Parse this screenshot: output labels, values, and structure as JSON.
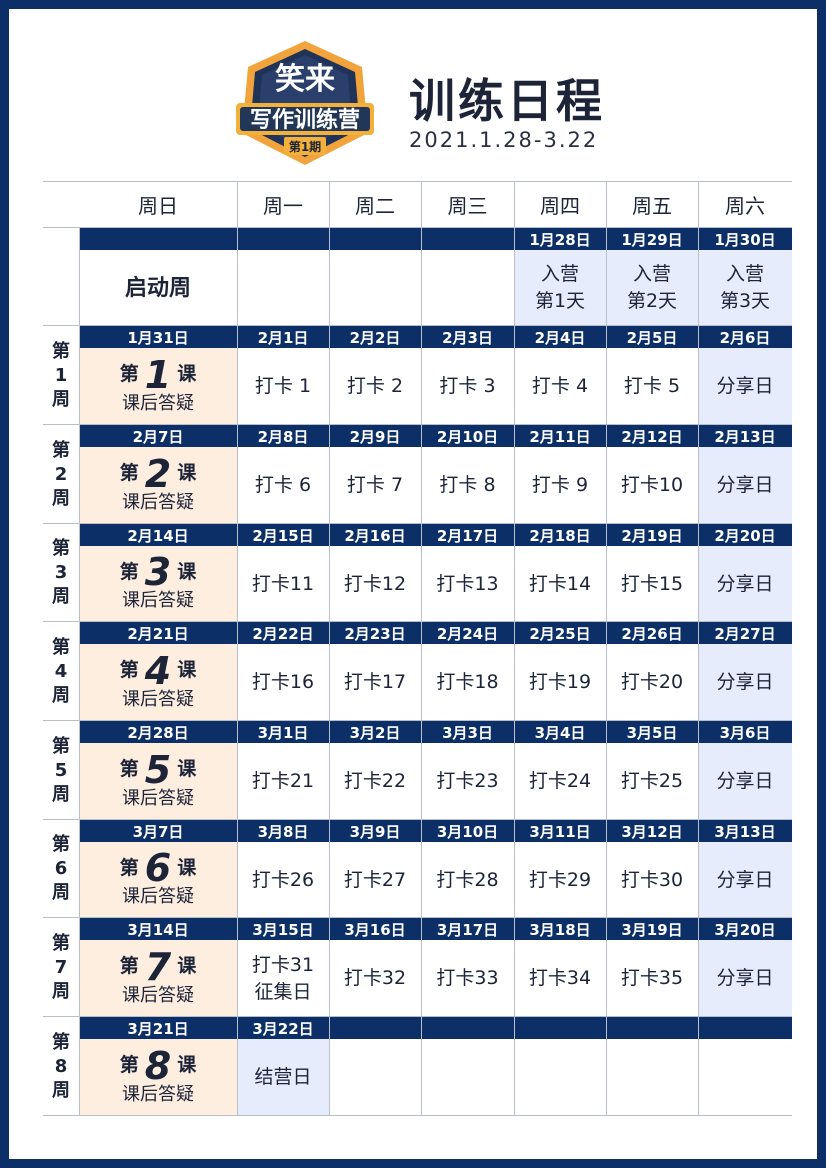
{
  "header": {
    "logo_text_top": "笑来",
    "logo_text_main": "写作训练营",
    "logo_badge": "第1期",
    "title": "训练日程",
    "subtitle": "2021.1.28-3.22"
  },
  "colors": {
    "navy": "#0b2f66",
    "peach": "#fdeee0",
    "light_blue": "#e6ecfb"
  },
  "days": [
    "周日",
    "周一",
    "周二",
    "周三",
    "周四",
    "周五",
    "周六"
  ],
  "launch_week": {
    "label": "启动周",
    "dates": [
      "",
      "",
      "",
      "",
      "1月28日",
      "1月29日",
      "1月30日"
    ],
    "cells": [
      {
        "text": ""
      },
      {
        "text": ""
      },
      {
        "text": ""
      },
      {
        "text": "入营\n第1天",
        "style": "blue"
      },
      {
        "text": "入营\n第2天",
        "style": "blue"
      },
      {
        "text": "入营\n第3天",
        "style": "blue"
      }
    ]
  },
  "weeks": [
    {
      "label": [
        "第",
        "1",
        "周"
      ],
      "lesson": {
        "prefix": "第",
        "num": "1",
        "suffix": "课",
        "sub": "课后答疑"
      },
      "dates": [
        "1月31日",
        "2月1日",
        "2月2日",
        "2月3日",
        "2月4日",
        "2月5日",
        "2月6日"
      ],
      "cells": [
        {
          "text": "打卡 1"
        },
        {
          "text": "打卡 2"
        },
        {
          "text": "打卡 3"
        },
        {
          "text": "打卡 4"
        },
        {
          "text": "打卡 5"
        },
        {
          "text": "分享日",
          "style": "blue"
        }
      ]
    },
    {
      "label": [
        "第",
        "2",
        "周"
      ],
      "lesson": {
        "prefix": "第",
        "num": "2",
        "suffix": "课",
        "sub": "课后答疑"
      },
      "dates": [
        "2月7日",
        "2月8日",
        "2月9日",
        "2月10日",
        "2月11日",
        "2月12日",
        "2月13日"
      ],
      "cells": [
        {
          "text": "打卡 6"
        },
        {
          "text": "打卡 7"
        },
        {
          "text": "打卡 8"
        },
        {
          "text": "打卡 9"
        },
        {
          "text": "打卡10"
        },
        {
          "text": "分享日",
          "style": "blue"
        }
      ]
    },
    {
      "label": [
        "第",
        "3",
        "周"
      ],
      "lesson": {
        "prefix": "第",
        "num": "3",
        "suffix": "课",
        "sub": "课后答疑"
      },
      "dates": [
        "2月14日",
        "2月15日",
        "2月16日",
        "2月17日",
        "2月18日",
        "2月19日",
        "2月20日"
      ],
      "cells": [
        {
          "text": "打卡11"
        },
        {
          "text": "打卡12"
        },
        {
          "text": "打卡13"
        },
        {
          "text": "打卡14"
        },
        {
          "text": "打卡15"
        },
        {
          "text": "分享日",
          "style": "blue"
        }
      ]
    },
    {
      "label": [
        "第",
        "4",
        "周"
      ],
      "lesson": {
        "prefix": "第",
        "num": "4",
        "suffix": "课",
        "sub": "课后答疑"
      },
      "dates": [
        "2月21日",
        "2月22日",
        "2月23日",
        "2月24日",
        "2月25日",
        "2月26日",
        "2月27日"
      ],
      "cells": [
        {
          "text": "打卡16"
        },
        {
          "text": "打卡17"
        },
        {
          "text": "打卡18"
        },
        {
          "text": "打卡19"
        },
        {
          "text": "打卡20"
        },
        {
          "text": "分享日",
          "style": "blue"
        }
      ]
    },
    {
      "label": [
        "第",
        "5",
        "周"
      ],
      "lesson": {
        "prefix": "第",
        "num": "5",
        "suffix": "课",
        "sub": "课后答疑"
      },
      "dates": [
        "2月28日",
        "3月1日",
        "3月2日",
        "3月3日",
        "3月4日",
        "3月5日",
        "3月6日"
      ],
      "cells": [
        {
          "text": "打卡21"
        },
        {
          "text": "打卡22"
        },
        {
          "text": "打卡23"
        },
        {
          "text": "打卡24"
        },
        {
          "text": "打卡25"
        },
        {
          "text": "分享日",
          "style": "blue"
        }
      ]
    },
    {
      "label": [
        "第",
        "6",
        "周"
      ],
      "lesson": {
        "prefix": "第",
        "num": "6",
        "suffix": "课",
        "sub": "课后答疑"
      },
      "dates": [
        "3月7日",
        "3月8日",
        "3月9日",
        "3月10日",
        "3月11日",
        "3月12日",
        "3月13日"
      ],
      "cells": [
        {
          "text": "打卡26"
        },
        {
          "text": "打卡27"
        },
        {
          "text": "打卡28"
        },
        {
          "text": "打卡29"
        },
        {
          "text": "打卡30"
        },
        {
          "text": "分享日",
          "style": "blue"
        }
      ]
    },
    {
      "label": [
        "第",
        "7",
        "周"
      ],
      "lesson": {
        "prefix": "第",
        "num": "7",
        "suffix": "课",
        "sub": "课后答疑"
      },
      "dates": [
        "3月14日",
        "3月15日",
        "3月16日",
        "3月17日",
        "3月18日",
        "3月19日",
        "3月20日"
      ],
      "cells": [
        {
          "text": "打卡31\n征集日"
        },
        {
          "text": "打卡32"
        },
        {
          "text": "打卡33"
        },
        {
          "text": "打卡34"
        },
        {
          "text": "打卡35"
        },
        {
          "text": "分享日",
          "style": "blue"
        }
      ]
    },
    {
      "label": [
        "第",
        "8",
        "周"
      ],
      "lesson": {
        "prefix": "第",
        "num": "8",
        "suffix": "课",
        "sub": "课后答疑"
      },
      "dates": [
        "3月21日",
        "3月22日",
        "",
        "",
        "",
        "",
        ""
      ],
      "cells": [
        {
          "text": "结营日",
          "style": "blue"
        },
        {
          "text": ""
        },
        {
          "text": ""
        },
        {
          "text": ""
        },
        {
          "text": ""
        },
        {
          "text": ""
        }
      ]
    }
  ]
}
